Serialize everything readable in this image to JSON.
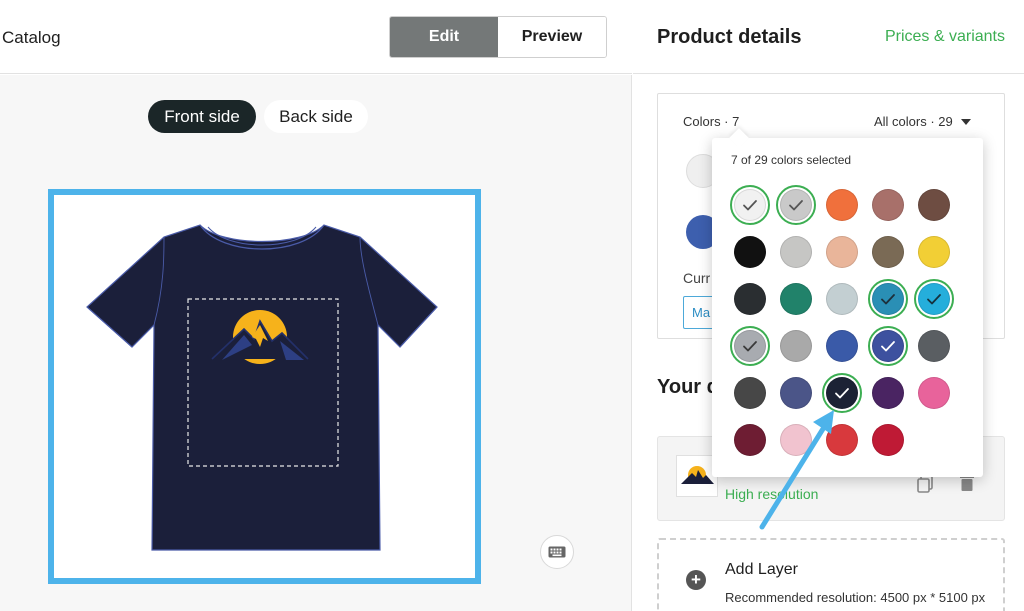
{
  "header": {
    "breadcrumb": "Catalog",
    "mode_edit": "Edit",
    "mode_preview": "Preview"
  },
  "editor": {
    "front_side": "Front side",
    "back_side": "Back side",
    "shirt_color": "#1b1f3a",
    "frame_color": "#4db3ea"
  },
  "panel": {
    "title": "Product details",
    "prices_link": "Prices & variants",
    "colors_label": "Colors · 7",
    "all_colors_label": "All colors · 29",
    "current_label": "Curr",
    "peek_button_label": "Ma",
    "your_heading": "Your d",
    "layer_label": "High resolution",
    "add_layer_title": "Add Layer",
    "add_layer_sub": "Recommended resolution: 4500 px * 5100 px"
  },
  "color_picker": {
    "title": "7 of 29 colors selected",
    "accent_ring": "#3cae52",
    "swatches": [
      {
        "color": "#f1f1f1",
        "selected": true,
        "check": "#555555"
      },
      {
        "color": "#c9c9c9",
        "selected": true,
        "check": "#555555"
      },
      {
        "color": "#f0703c",
        "selected": false
      },
      {
        "color": "#a8706a",
        "selected": false
      },
      {
        "color": "#6e4d42",
        "selected": false
      },
      {
        "color": "#111111",
        "selected": false
      },
      {
        "color": "#c6c6c4",
        "selected": false
      },
      {
        "color": "#e9b59a",
        "selected": false
      },
      {
        "color": "#7a6a55",
        "selected": false
      },
      {
        "color": "#f2cf35",
        "selected": false
      },
      {
        "color": "#2a2e31",
        "selected": false
      },
      {
        "color": "#21826a",
        "selected": false
      },
      {
        "color": "#c3cfd2",
        "selected": false
      },
      {
        "color": "#2a8fb5",
        "selected": true,
        "check": "#1d2f3a"
      },
      {
        "color": "#25aedb",
        "selected": true,
        "check": "#15323e"
      },
      {
        "color": "#a8abb0",
        "selected": true,
        "check": "#3a3a3a"
      },
      {
        "color": "#a9a9a9",
        "selected": false
      },
      {
        "color": "#3a5aa8",
        "selected": false
      },
      {
        "color": "#3d519f",
        "selected": true,
        "check": "#ffffff"
      },
      {
        "color": "#5a5e62",
        "selected": false
      },
      {
        "color": "#474747",
        "selected": false
      },
      {
        "color": "#4b5588",
        "selected": false
      },
      {
        "color": "#1c2235",
        "selected": true,
        "check": "#ffffff"
      },
      {
        "color": "#4a2462",
        "selected": false
      },
      {
        "color": "#e8639b",
        "selected": false
      },
      {
        "color": "#6e1d33",
        "selected": false
      },
      {
        "color": "#f1c3cf",
        "selected": false
      },
      {
        "color": "#d8393d",
        "selected": false
      },
      {
        "color": "#bf1a35",
        "selected": false
      }
    ]
  },
  "icons": {
    "keyboard": "keyboard-icon",
    "copy": "copy-icon",
    "trash": "trash-icon",
    "plus": "plus-circle-icon",
    "caret": "caret-down-icon",
    "check": "check-icon"
  }
}
